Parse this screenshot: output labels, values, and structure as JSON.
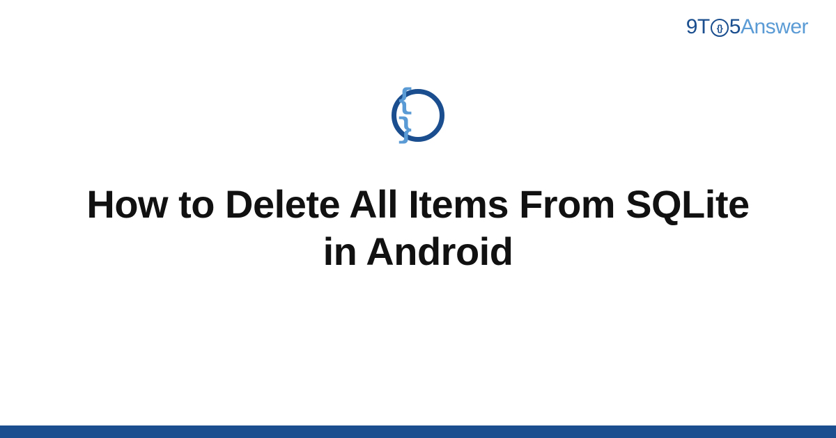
{
  "header": {
    "logo": {
      "part1": "9T",
      "part_o_inner": "{}",
      "part2": "5",
      "part3": "Answer"
    }
  },
  "icon": {
    "name": "code-braces-icon",
    "glyph": "{ }"
  },
  "main": {
    "title": "How to Delete All Items From SQLite in Android"
  },
  "colors": {
    "primary_dark": "#1a4e8e",
    "primary_light": "#5b9bd5",
    "text": "#111111",
    "background": "#ffffff"
  }
}
